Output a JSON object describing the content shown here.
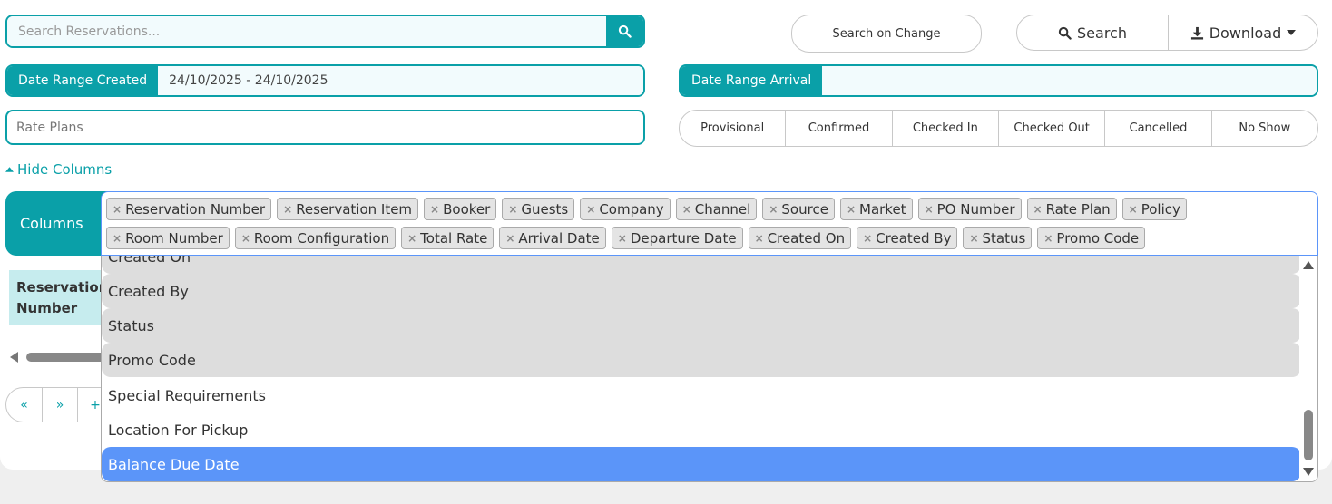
{
  "search": {
    "placeholder": "Search Reservations..."
  },
  "toolbar": {
    "search_on_change": "Search on Change",
    "search_label": "Search",
    "download_label": "Download"
  },
  "date_range_created": {
    "label": "Date Range Created",
    "value": "24/10/2025 - 24/10/2025"
  },
  "date_range_arrival": {
    "label": "Date Range Arrival",
    "value": ""
  },
  "rate_plans": {
    "placeholder": "Rate Plans"
  },
  "status_filters": [
    "Provisional",
    "Confirmed",
    "Checked In",
    "Checked Out",
    "Cancelled",
    "No Show"
  ],
  "hide_columns_label": "Hide Columns",
  "columns": {
    "label": "Columns",
    "selected": [
      "Reservation Number",
      "Reservation Item",
      "Booker",
      "Guests",
      "Company",
      "Channel",
      "Source",
      "Market",
      "PO Number",
      "Rate Plan",
      "Policy",
      "Room Number",
      "Room Configuration",
      "Total Rate",
      "Arrival Date",
      "Departure Date",
      "Created On",
      "Created By",
      "Status",
      "Promo Code"
    ]
  },
  "dropdown": {
    "options": [
      {
        "label": "Created On",
        "state": "selected"
      },
      {
        "label": "Created By",
        "state": "selected"
      },
      {
        "label": "Status",
        "state": "selected"
      },
      {
        "label": "Promo Code",
        "state": "selected"
      },
      {
        "label": "Special Requirements",
        "state": "none"
      },
      {
        "label": "Location For Pickup",
        "state": "none"
      },
      {
        "label": "Balance Due Date",
        "state": "highlighted"
      }
    ]
  },
  "table": {
    "first_header": "Reservation Number"
  },
  "pager": [
    "«",
    "»",
    "+"
  ],
  "colors": {
    "accent": "#0aa0a8",
    "highlight": "#5b95f9",
    "selected_bg": "#dddddd"
  }
}
